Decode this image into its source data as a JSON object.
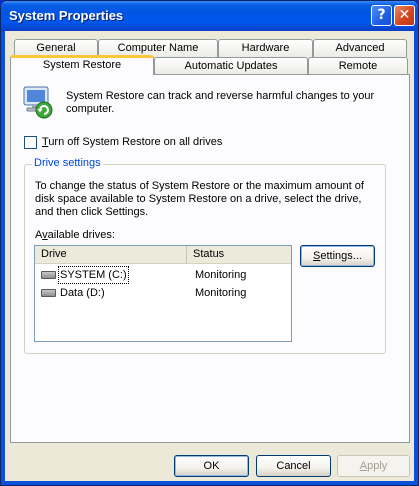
{
  "window": {
    "title": "System Properties"
  },
  "titlebar": {
    "help_glyph": "?",
    "close_glyph": "✕"
  },
  "tabs": [
    {
      "label": "General"
    },
    {
      "label": "Computer Name"
    },
    {
      "label": "Hardware"
    },
    {
      "label": "Advanced"
    },
    {
      "label": "System Restore",
      "active": true
    },
    {
      "label": "Automatic Updates"
    },
    {
      "label": "Remote"
    }
  ],
  "system_restore": {
    "icon": "system-restore-icon",
    "intro_text": "System Restore can track and reverse harmful changes to your computer.",
    "turn_off_checkbox": {
      "label_prefix": "",
      "label_accel": "T",
      "label_rest": "urn off System Restore on all drives",
      "checked": false
    },
    "drive_settings": {
      "legend": "Drive settings",
      "description": "To change the status of System Restore or the maximum amount of disk space available to System Restore on a drive, select the drive, and then click Settings.",
      "available_label_prefix": "A",
      "available_label_accel": "v",
      "available_label_rest": "ailable drives:",
      "columns": {
        "drive": "Drive",
        "status": "Status"
      },
      "drives": [
        {
          "name": "SYSTEM (C:)",
          "status": "Monitoring",
          "icon": "hard-drive-icon"
        },
        {
          "name": "Data (D:)",
          "status": "Monitoring",
          "icon": "hard-drive-icon"
        }
      ],
      "settings_button": {
        "accel": "S",
        "rest": "ettings..."
      }
    }
  },
  "footer": {
    "ok": "OK",
    "cancel": "Cancel",
    "apply_accel": "A",
    "apply_rest": "pply"
  },
  "colors": {
    "titlebar": "#0054e3",
    "dialog_bg": "#ece9d8",
    "panel_bg": "#fcfcfe",
    "active_tab_accent": "#ffc83c",
    "group_legend": "#0046d5"
  }
}
